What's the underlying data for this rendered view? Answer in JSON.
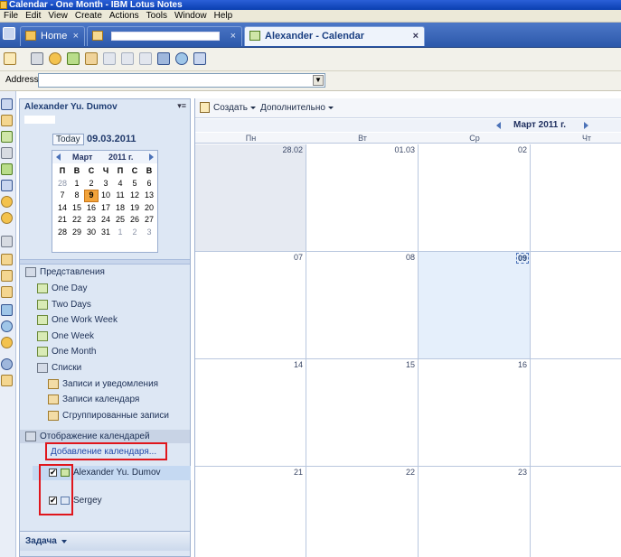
{
  "window": {
    "title": "Calendar - One Month - IBM Lotus Notes"
  },
  "menu": [
    "File",
    "Edit",
    "View",
    "Create",
    "Actions",
    "Tools",
    "Window",
    "Help"
  ],
  "tabs": [
    {
      "label": "Home",
      "close": "×"
    },
    {
      "label": "",
      "close": "×"
    },
    {
      "label": "Alexander - Calendar",
      "close": "×"
    }
  ],
  "address": {
    "label": "Address",
    "value": ""
  },
  "left_panel": {
    "owner": "Alexander Yu. Dumov",
    "menu_glyph": "▾≡",
    "today_label": "Today",
    "current_date": "09.03.2011",
    "mini_calendar": {
      "month": "Март",
      "year": "2011 г.",
      "weekday_headers": [
        "П",
        "В",
        "С",
        "Ч",
        "П",
        "С",
        "В"
      ],
      "weeks": [
        [
          [
            "28",
            "other"
          ],
          [
            "1",
            ""
          ],
          [
            "2",
            ""
          ],
          [
            "3",
            ""
          ],
          [
            "4",
            ""
          ],
          [
            "5",
            ""
          ],
          [
            "6",
            ""
          ]
        ],
        [
          [
            "7",
            ""
          ],
          [
            "8",
            ""
          ],
          [
            "9",
            "today"
          ],
          [
            "10",
            ""
          ],
          [
            "11",
            ""
          ],
          [
            "12",
            ""
          ],
          [
            "13",
            ""
          ]
        ],
        [
          [
            "14",
            ""
          ],
          [
            "15",
            ""
          ],
          [
            "16",
            ""
          ],
          [
            "17",
            ""
          ],
          [
            "18",
            ""
          ],
          [
            "19",
            ""
          ],
          [
            "20",
            ""
          ]
        ],
        [
          [
            "21",
            ""
          ],
          [
            "22",
            ""
          ],
          [
            "23",
            ""
          ],
          [
            "24",
            ""
          ],
          [
            "25",
            ""
          ],
          [
            "26",
            ""
          ],
          [
            "27",
            ""
          ]
        ],
        [
          [
            "28",
            ""
          ],
          [
            "29",
            ""
          ],
          [
            "30",
            ""
          ],
          [
            "31",
            ""
          ],
          [
            "1",
            "other"
          ],
          [
            "2",
            "other"
          ],
          [
            "3",
            "other"
          ]
        ]
      ]
    },
    "views_header": "Представления",
    "views": [
      "One Day",
      "Two Days",
      "One Work Week",
      "One Week",
      "One Month"
    ],
    "lists_header": "Списки",
    "lists": [
      "Записи и уведомления",
      "Записи календаря",
      "Сгруппированные записи"
    ],
    "calendars_header": "Отображение календарей",
    "add_calendar": "Добавление календаря...",
    "calendars": [
      {
        "name": "Alexander Yu. Dumov",
        "checked": "✔"
      },
      {
        "name": "Sergey",
        "checked": "✔"
      }
    ],
    "task_header": "Задача"
  },
  "main": {
    "create_label": "Создать",
    "more_label": "Дополнительно",
    "month_title": "Март 2011 г.",
    "weekdays": [
      "Пн",
      "Вт",
      "Ср",
      "Чт"
    ],
    "weeks": [
      [
        "28.02",
        "01.03",
        "02",
        ""
      ],
      [
        "07",
        "08",
        "09",
        ""
      ],
      [
        "14",
        "15",
        "16",
        ""
      ],
      [
        "21",
        "22",
        "23",
        ""
      ]
    ]
  },
  "colors": {
    "accent": "#2c58aa",
    "highlight_box": "#e0161c",
    "today": "#f2a33a"
  }
}
